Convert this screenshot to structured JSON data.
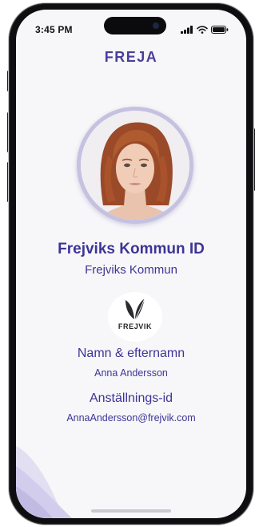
{
  "status_bar": {
    "time": "3:45 PM",
    "icons": [
      "signal-icon",
      "wifi-icon",
      "battery-icon"
    ]
  },
  "app": {
    "brand": "FREJA"
  },
  "profile": {
    "photo": "portrait-photo",
    "id_title": "Frejviks Kommun ID",
    "organization": "Frejviks Kommun",
    "org_logo_text": "FREJVIK"
  },
  "fields": [
    {
      "label": "Namn & efternamn",
      "value": "Anna Andersson"
    },
    {
      "label": "Anställnings-id",
      "value": "AnnaAndersson@frejvik.com"
    }
  ],
  "colors": {
    "accent": "#3d3496",
    "brand": "#4b3f9a",
    "ring": "#c5c1e0",
    "background": "#f7f7f9"
  }
}
